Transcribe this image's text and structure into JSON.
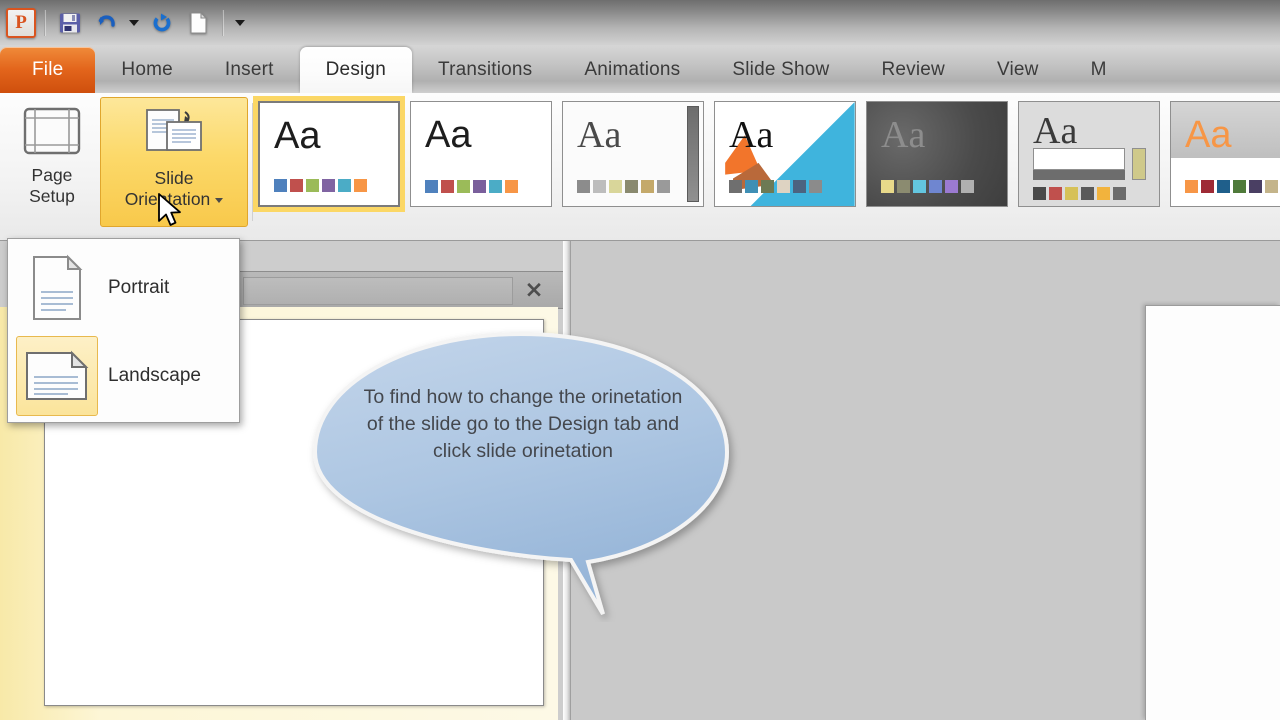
{
  "quick_access": {
    "app_icon": "powerpoint-logo",
    "app_letter": "P",
    "buttons": [
      {
        "name": "save-icon",
        "label": "Save"
      },
      {
        "name": "undo-icon",
        "label": "Undo"
      },
      {
        "name": "undo-dropdown-caret-icon",
        "label": "Undo options"
      },
      {
        "name": "redo-icon",
        "label": "Redo"
      },
      {
        "name": "new-document-icon",
        "label": "New"
      },
      {
        "name": "customize-quick-access-caret-icon",
        "label": "Customize Quick Access Toolbar"
      }
    ]
  },
  "ribbon": {
    "tabs": [
      {
        "label": "File",
        "state": "file"
      },
      {
        "label": "Home",
        "state": "normal"
      },
      {
        "label": "Insert",
        "state": "normal"
      },
      {
        "label": "Design",
        "state": "active"
      },
      {
        "label": "Transitions",
        "state": "normal"
      },
      {
        "label": "Animations",
        "state": "normal"
      },
      {
        "label": "Slide Show",
        "state": "normal"
      },
      {
        "label": "Review",
        "state": "normal"
      },
      {
        "label": "View",
        "state": "normal"
      },
      {
        "label": "M",
        "state": "normal"
      }
    ],
    "page_setup_group": {
      "page_setup": {
        "line1": "Page",
        "line2": "Setup"
      },
      "slide_orientation": {
        "line1": "Slide",
        "line2": "Orientation",
        "highlighted": true
      }
    },
    "themes": [
      {
        "name": "theme-office",
        "selected": true,
        "aa": "Aa",
        "font": "sans",
        "bg": "#ffffff",
        "text": "#1d1d1d",
        "swatches": [
          "#4f81bd",
          "#c0504d",
          "#9bbb59",
          "#8064a2",
          "#4bacc6",
          "#f79646"
        ]
      },
      {
        "name": "theme-adjacency",
        "selected": false,
        "aa": "Aa",
        "font": "sans",
        "bg": "#ffffff",
        "text": "#1d1d1d",
        "swatches": [
          "#4f81bd",
          "#c0504d",
          "#9bbb59",
          "#7a5f9c",
          "#4bacc6",
          "#f79646"
        ]
      },
      {
        "name": "theme-angles",
        "selected": false,
        "aa": "Aa",
        "font": "serif",
        "bg": "#fbfbfb",
        "text": "#4a4a4a",
        "swatches": [
          "#8c8c8c",
          "#bdbdbd",
          "#d9d69a",
          "#8a8a6f",
          "#c4a96a",
          "#9a9a9a"
        ]
      },
      {
        "name": "theme-apex",
        "selected": false,
        "aa": "Aa",
        "font": "serif",
        "bg": "#ffffff",
        "text": "#141414",
        "swatches": [
          "#6f6f6f",
          "#3f8fb5",
          "#6d7a54",
          "#ded3c2",
          "#4c6380",
          "#8b8b8b"
        ]
      },
      {
        "name": "theme-apothecary",
        "selected": false,
        "aa": "Aa",
        "font": "serif",
        "bg": "#4f4f4f",
        "text": "#8d8d8d",
        "swatches": [
          "#e8d98a",
          "#8b8b70",
          "#63c6e0",
          "#6f86d0",
          "#9b7ad1",
          "#b0b0b0"
        ]
      },
      {
        "name": "theme-aspect",
        "selected": false,
        "aa": "Aa",
        "font": "serif",
        "bg": "#dcdcdc",
        "text": "#3a3a3a",
        "swatches": [
          "#4a4a4a",
          "#c0504d",
          "#d6c158",
          "#5a5a5a",
          "#f2b33d",
          "#6b6b6b"
        ]
      },
      {
        "name": "theme-austin",
        "selected": false,
        "aa": "Aa",
        "font": "sans",
        "bg": "#ffffff",
        "text": "#f79646",
        "swatches": [
          "#f79646",
          "#9e2a35",
          "#1f5f8b",
          "#4f7a3a",
          "#4a3f63",
          "#c4b48a"
        ]
      }
    ]
  },
  "orientation_menu": {
    "items": [
      {
        "label": "Portrait",
        "icon": "portrait-page-icon",
        "selected": false
      },
      {
        "label": "Landscape",
        "icon": "landscape-page-icon",
        "selected": true
      }
    ]
  },
  "editor": {
    "panel_close_label": "×",
    "callout": {
      "text": "To find how to change the orinetation of the slide go to the Design tab and click slide orinetation",
      "fill_from": "#b8cde5",
      "fill_to": "#9dbbdd",
      "text_color": "#44474d"
    }
  },
  "colors": {
    "accent_orange": "#e2641b",
    "highlight_yellow": "#fbd765",
    "workarea_gray": "#c9c9c9"
  }
}
